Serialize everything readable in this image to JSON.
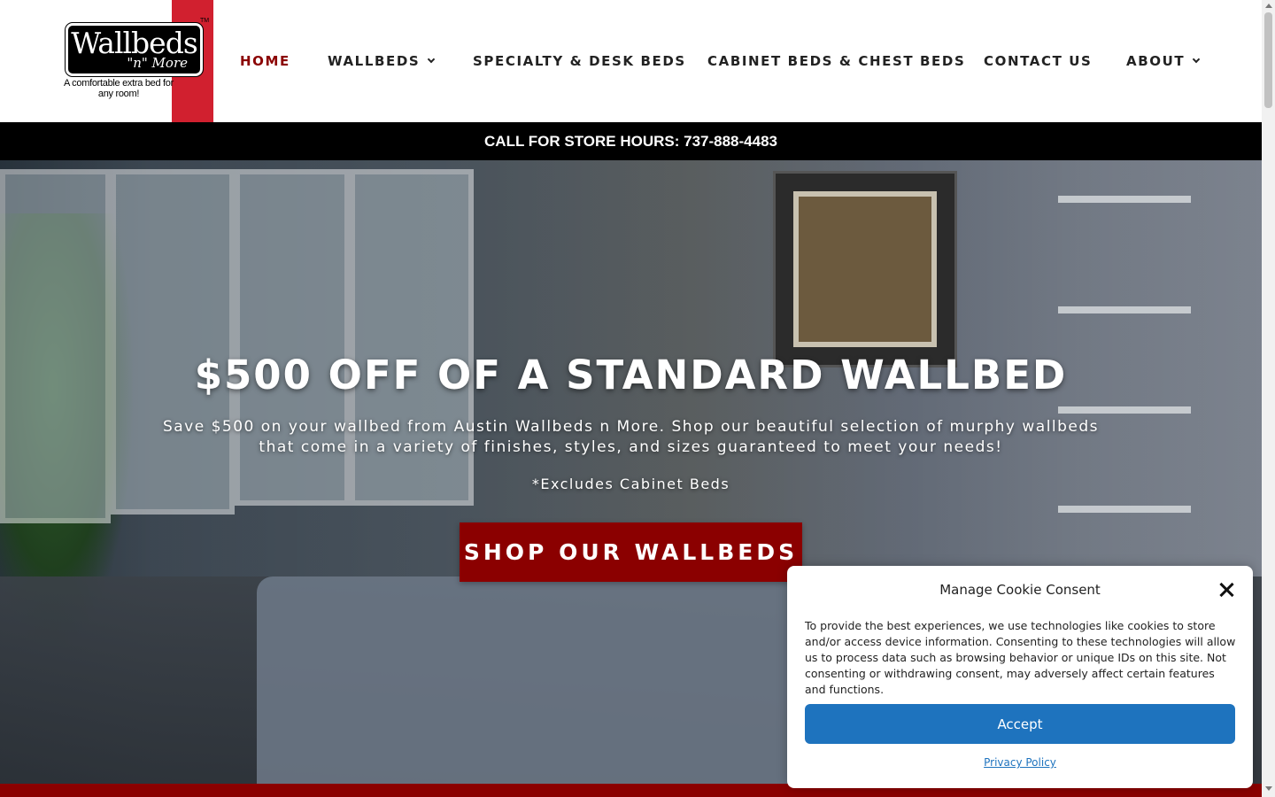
{
  "logo": {
    "word": "Wallbeds",
    "sub": "\"n\" More",
    "tm": "TM",
    "tagline": "A comfortable extra bed for any room!"
  },
  "nav": {
    "home": "HOME",
    "wallbeds": "WALLBEDS",
    "specialty": "SPECIALTY & DESK BEDS",
    "cabinet": "CABINET BEDS & CHEST BEDS",
    "contact": "CONTACT US",
    "about": "ABOUT"
  },
  "topbar": {
    "text": "CALL FOR STORE HOURS: 737-888-4483"
  },
  "hero": {
    "title": "$500 OFF OF A STANDARD WALLBED",
    "subtitle": "Save $500 on your wallbed from Austin Wallbeds n More. Shop our beautiful selection of murphy wallbeds that come in a variety of finishes, styles, and sizes guaranteed to meet your needs!",
    "note": "*Excludes Cabinet Beds",
    "button": "SHOP OUR WALLBEDS"
  },
  "cookie": {
    "title": "Manage Cookie Consent",
    "text": "To provide the best experiences, we use technologies like cookies to store and/or access device information. Consenting to these technologies will allow us to process data such as browsing behavior or unique IDs on this site. Not consenting or withdrawing consent, may adversely affect certain features and functions.",
    "accept": "Accept",
    "privacy": "Privacy Policy"
  },
  "colors": {
    "brand_red": "#8b0000",
    "logo_red": "#d1202f",
    "accept_blue": "#1e73be",
    "topbar_bg": "#000000"
  },
  "icons": [
    "chevron-down-icon",
    "close-icon",
    "scroll-up-icon",
    "scroll-down-icon"
  ]
}
